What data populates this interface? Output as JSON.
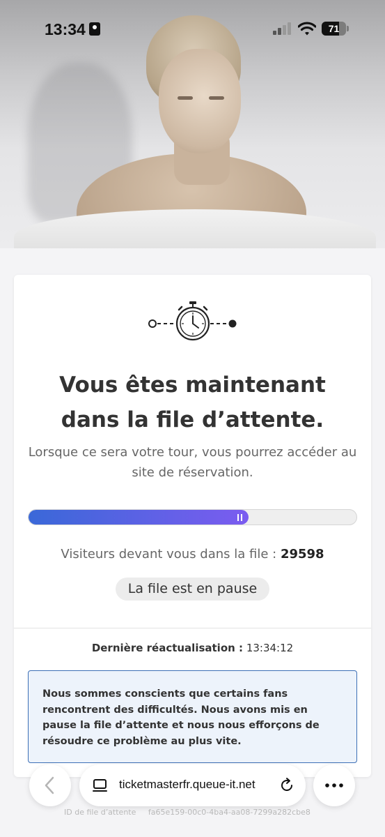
{
  "status_bar": {
    "time": "13:34",
    "battery_level": "71",
    "battery_fraction": 0.71,
    "icons": [
      "focus-icon",
      "signal-icon",
      "wifi-icon",
      "battery-icon"
    ]
  },
  "hero": {
    "alt": "artist-photo"
  },
  "card": {
    "title": "Vous êtes maintenant dans la file d’attente.",
    "subtitle": "Lorsque ce sera votre tour, vous pourrez accéder au site de réservation.",
    "progress_fraction": 0.67,
    "visitors_label": "Visiteurs devant vous dans la file :",
    "visitors_count": "29598",
    "paused_badge": "La file est en pause",
    "last_refresh_label": "Dernière réactualisation :",
    "last_refresh_time": "13:34:12",
    "notice": "Nous sommes conscients que certains fans rencontrent des difficultés. Nous avons mis en pause la file d’attente et nous nous efforçons de résoudre ce problème au plus vite."
  },
  "browser": {
    "url": "ticketmasterfr.queue-it.net",
    "queue_id_label": "ID de file d’attente",
    "queue_id": "fa65e159-00c0-4ba4-aa08-7299a282cbe8"
  },
  "colors": {
    "progress_start": "#3a68d8",
    "progress_end": "#7b5cf0",
    "notice_border": "#3c6fb6",
    "notice_bg": "#edf3fb"
  }
}
